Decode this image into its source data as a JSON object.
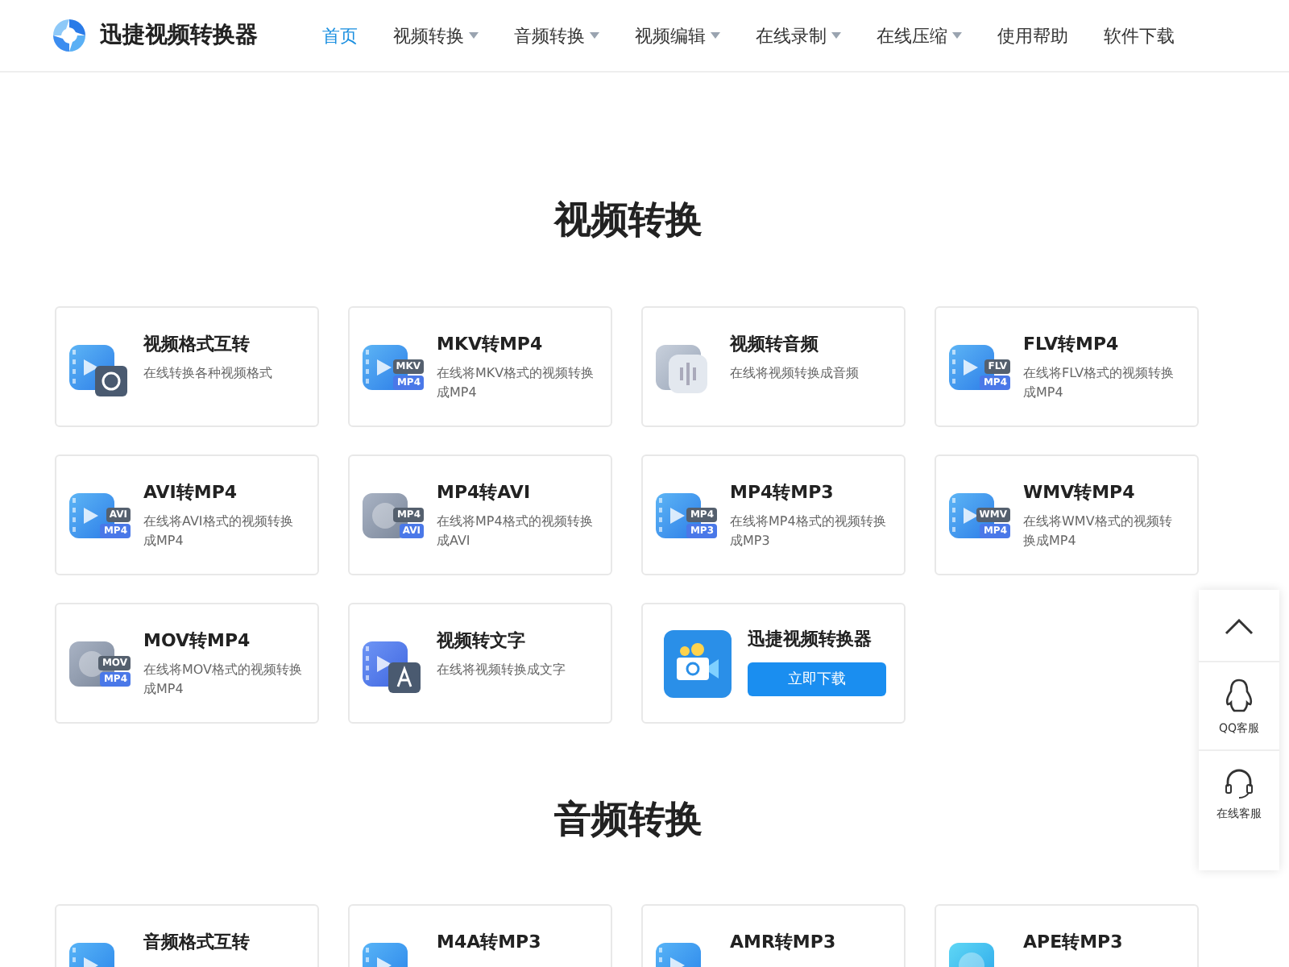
{
  "brand": {
    "name": "迅捷视频转换器"
  },
  "nav": [
    {
      "label": "首页",
      "selected": true,
      "dropdown": false
    },
    {
      "label": "视频转换",
      "selected": false,
      "dropdown": true
    },
    {
      "label": "音频转换",
      "selected": false,
      "dropdown": true
    },
    {
      "label": "视频编辑",
      "selected": false,
      "dropdown": true
    },
    {
      "label": "在线录制",
      "selected": false,
      "dropdown": true
    },
    {
      "label": "在线压缩",
      "selected": false,
      "dropdown": true
    },
    {
      "label": "使用帮助",
      "selected": false,
      "dropdown": false
    },
    {
      "label": "软件下载",
      "selected": false,
      "dropdown": false
    }
  ],
  "sections": [
    {
      "title": "视频转换",
      "cards": [
        {
          "kind": "convert",
          "title": "视频格式互转",
          "desc": "在线转换各种视频格式"
        },
        {
          "kind": "film",
          "badges": [
            "MKV",
            "MP4"
          ],
          "title": "MKV转MP4",
          "desc": "在线将MKV格式的视频转换成MP4"
        },
        {
          "kind": "audio",
          "title": "视频转音频",
          "desc": "在线将视频转换成音频"
        },
        {
          "kind": "film",
          "badges": [
            "FLV",
            "MP4"
          ],
          "title": "FLV转MP4",
          "desc": "在线将FLV格式的视频转换成MP4"
        },
        {
          "kind": "film",
          "badges": [
            "AVI",
            "MP4"
          ],
          "title": "AVI转MP4",
          "desc": "在线将AVI格式的视频转换成MP4"
        },
        {
          "kind": "reel",
          "badges": [
            "MP4",
            "AVI"
          ],
          "title": "MP4转AVI",
          "desc": "在线将MP4格式的视频转换成AVI"
        },
        {
          "kind": "film",
          "badges": [
            "MP4",
            "MP3"
          ],
          "title": "MP4转MP3",
          "desc": "在线将MP4格式的视频转换成MP3"
        },
        {
          "kind": "film",
          "badges": [
            "WMV",
            "MP4"
          ],
          "title": "WMV转MP4",
          "desc": "在线将WMV格式的视频转换成MP4"
        },
        {
          "kind": "reel",
          "badges": [
            "MOV",
            "MP4"
          ],
          "title": "MOV转MP4",
          "desc": "在线将MOV格式的视频转换成MP4"
        },
        {
          "kind": "text",
          "title": "视频转文字",
          "desc": "在线将视频转换成文字"
        },
        {
          "kind": "promo",
          "title": "迅捷视频转换器",
          "button": "立即下载"
        }
      ]
    },
    {
      "title": "音频转换",
      "cards": [
        {
          "kind": "music",
          "title": "音频格式互转"
        },
        {
          "kind": "music",
          "title": "M4A转MP3"
        },
        {
          "kind": "music",
          "title": "AMR转MP3"
        },
        {
          "kind": "disc",
          "title": "APE转MP3"
        }
      ]
    }
  ],
  "float_bar": [
    {
      "kind": "top"
    },
    {
      "kind": "qq",
      "label": "QQ客服"
    },
    {
      "kind": "headset",
      "label": "在线客服"
    }
  ]
}
